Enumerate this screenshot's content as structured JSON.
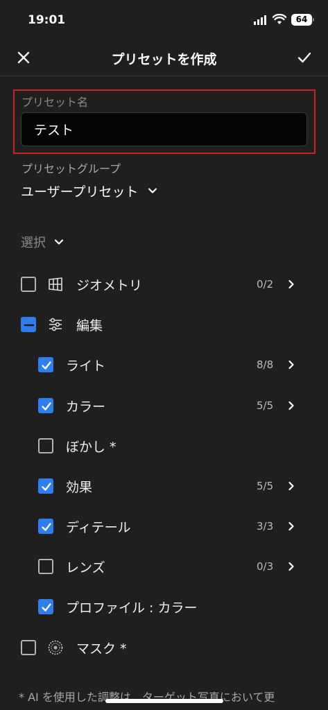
{
  "status_bar": {
    "time": "19:01",
    "battery": "64"
  },
  "nav": {
    "title": "プリセットを作成"
  },
  "preset_name": {
    "label": "プリセット名",
    "value": "テスト"
  },
  "preset_group": {
    "label": "プリセットグループ",
    "value": "ユーザープリセット"
  },
  "select": {
    "label": "選択"
  },
  "items": {
    "geometry": {
      "label": "ジオメトリ",
      "count": "0/2",
      "checked": false
    },
    "edit": {
      "label": "編集",
      "state": "mixed"
    },
    "light": {
      "label": "ライト",
      "count": "8/8",
      "checked": true
    },
    "color": {
      "label": "カラー",
      "count": "5/5",
      "checked": true
    },
    "blur": {
      "label": "ぼかし *",
      "checked": false
    },
    "effects": {
      "label": "効果",
      "count": "5/5",
      "checked": true
    },
    "detail": {
      "label": "ディテール",
      "count": "3/3",
      "checked": true
    },
    "lens": {
      "label": "レンズ",
      "count": "0/3",
      "checked": false
    },
    "profile": {
      "label": "プロファイル : カラー",
      "checked": true
    },
    "mask": {
      "label": "マスク *",
      "checked": false
    }
  },
  "footnote": "* AI を使用した調整は、ターゲット写真において更",
  "colors": {
    "accent": "#2d7ef0",
    "highlight_border": "#d21f24",
    "background": "#1f1f1f"
  }
}
